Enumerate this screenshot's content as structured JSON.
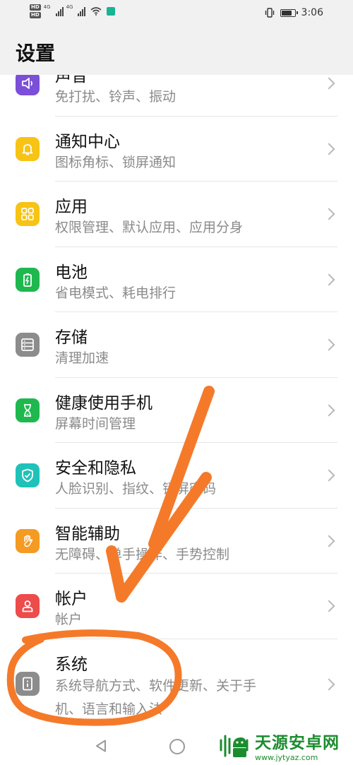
{
  "status_bar": {
    "time": "3:06",
    "hd1": "HD",
    "hd2": "HD",
    "net1": "4G",
    "net2": "4G",
    "battery_level": 0.8
  },
  "header": {
    "title": "设置"
  },
  "items": [
    {
      "title": "声音",
      "subtitle": "免打扰、铃声、振动",
      "icon": "speaker-icon",
      "color": "#7b4fd8"
    },
    {
      "title": "通知中心",
      "subtitle": "图标角标、锁屏通知",
      "icon": "bell-icon",
      "color": "#f7c315"
    },
    {
      "title": "应用",
      "subtitle": "权限管理、默认应用、应用分身",
      "icon": "apps-grid-icon",
      "color": "#f7c315"
    },
    {
      "title": "电池",
      "subtitle": "省电模式、耗电排行",
      "icon": "battery-icon",
      "color": "#1fb84f"
    },
    {
      "title": "存储",
      "subtitle": "清理加速",
      "icon": "storage-icon",
      "color": "#8c8c8c"
    },
    {
      "title": "健康使用手机",
      "subtitle": "屏幕时间管理",
      "icon": "hourglass-icon",
      "color": "#1fb84f"
    },
    {
      "title": "安全和隐私",
      "subtitle": "人脸识别、指纹、锁屏密码",
      "icon": "shield-icon",
      "color": "#1ec2b8"
    },
    {
      "title": "智能辅助",
      "subtitle": "无障碍、单手操作、手势控制",
      "icon": "hand-icon",
      "color": "#f59a23"
    },
    {
      "title": "帐户",
      "subtitle": "帐户",
      "icon": "account-icon",
      "color": "#ee4b4b"
    },
    {
      "title": "系统",
      "subtitle": "系统导航方式、软件更新、关于手",
      "subtitle2": "机、语言和输入法",
      "icon": "system-info-icon",
      "color": "#8c8c8c"
    }
  ],
  "watermark": {
    "name": "天源安卓网",
    "url": "www.jytyaz.com"
  },
  "annotation": {
    "color": "#f47a2a"
  }
}
